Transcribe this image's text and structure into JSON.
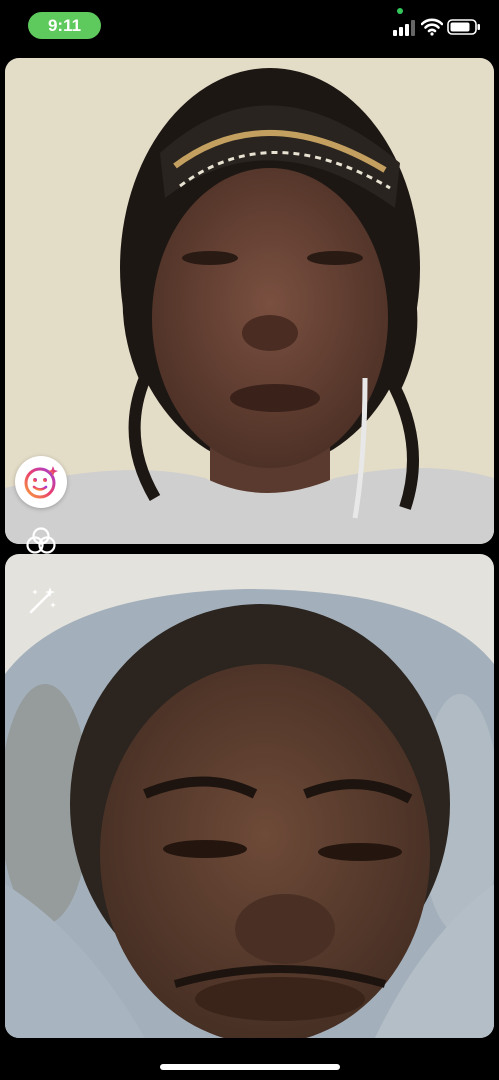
{
  "status_bar": {
    "time": "9:11",
    "time_pill_color": "#5ec95c",
    "privacy_dot_color": "#34c759",
    "icons": [
      "signal-bars-icon",
      "wifi-icon",
      "battery-icon"
    ]
  },
  "video_call": {
    "participants": [
      "remote-participant-video",
      "self-camera-video"
    ]
  },
  "controls": {
    "icons": [
      "effects-face-icon",
      "filters-circles-icon",
      "magic-wand-icon"
    ]
  }
}
